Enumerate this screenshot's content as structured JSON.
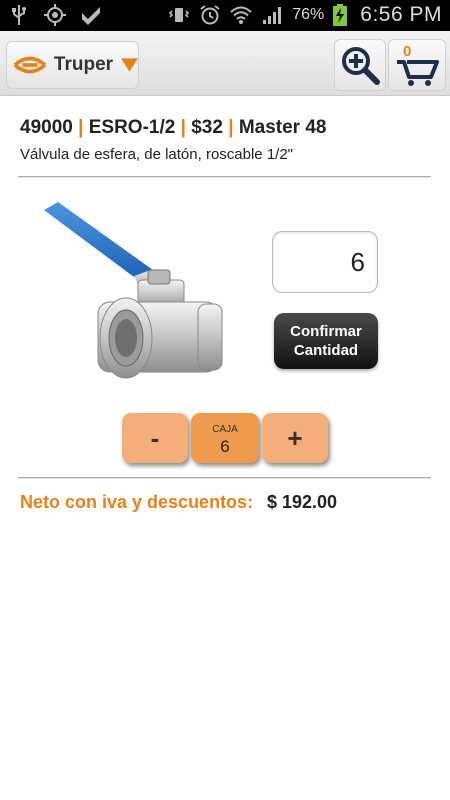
{
  "status_bar": {
    "battery_percent": "76%",
    "time": "6:56 PM",
    "left_icons": [
      "usb-icon",
      "gps-icon",
      "check-shield-icon"
    ],
    "right_icons": [
      "vibrate-icon",
      "alarm-icon",
      "wifi-icon",
      "signal-icon",
      "battery-charging-icon"
    ]
  },
  "app_bar": {
    "brand": "Truper",
    "cart_count": "0"
  },
  "product": {
    "code": "49000",
    "sku": "ESRO-1/2",
    "price": "$32",
    "master": "Master 48",
    "description": "Válvula de esfera, de latón, roscable 1/2\""
  },
  "order": {
    "quantity_value": "6",
    "confirm_label_line1": "Confirmar",
    "confirm_label_line2": "Cantidad",
    "minus_label": "-",
    "plus_label": "+",
    "unit_label": "CAJA",
    "unit_count": "6"
  },
  "totals": {
    "label": "Neto con iva y descuentos:",
    "value": "$ 192.00"
  },
  "colors": {
    "accent": "#e8801e",
    "stepper": "#f3ae79",
    "unit_box": "#f09a4e",
    "valve_handle": "#2f7dd1"
  }
}
